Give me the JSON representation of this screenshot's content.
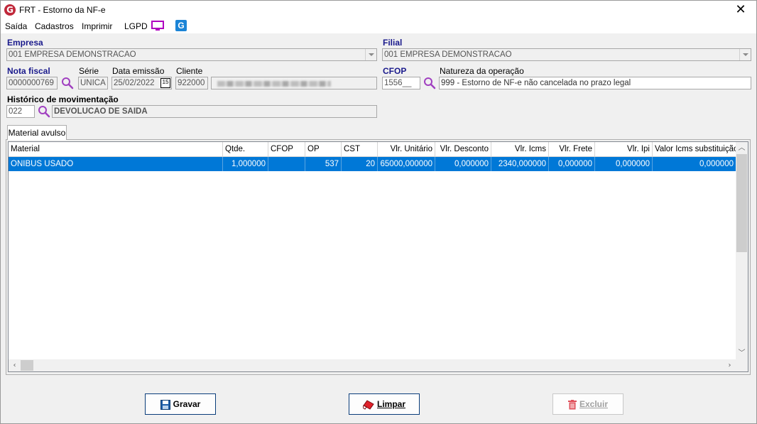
{
  "window": {
    "title": "FRT - Estorno da NF-e",
    "logo_letter": "G"
  },
  "menu": {
    "items": [
      "Saída",
      "Cadastros",
      "Imprimir",
      "LGPD"
    ],
    "g_icon_letter": "G"
  },
  "form": {
    "empresa": {
      "label": "Empresa",
      "value": "001 EMPRESA DEMONSTRACAO"
    },
    "filial": {
      "label": "Filial",
      "value": "001 EMPRESA DEMONSTRACAO"
    },
    "nota_fiscal": {
      "label": "Nota fiscal",
      "value": "0000000769"
    },
    "serie": {
      "label": "Série",
      "value": "UNICA"
    },
    "data_emissao": {
      "label": "Data emissão",
      "value": "25/02/2022",
      "calendar_text": "15"
    },
    "cliente": {
      "label": "Cliente",
      "code": "922000"
    },
    "cfop": {
      "label": "CFOP",
      "value": "1556__"
    },
    "natureza": {
      "label": "Natureza da operação",
      "value": "999 - Estorno de NF-e não cancelada no prazo legal"
    },
    "historico": {
      "label": "Histórico de movimentação",
      "code": "022",
      "description": "DEVOLUCAO DE SAIDA"
    }
  },
  "tabs": [
    {
      "label": "Material avulso"
    }
  ],
  "grid": {
    "columns": [
      "Material",
      "Qtde.",
      "CFOP",
      "OP",
      "CST",
      "Vlr. Unitário",
      "Vlr. Desconto",
      "Vlr. Icms",
      "Vlr. Frete",
      "Vlr. Ipi",
      "Valor Icms substituição"
    ],
    "rows": [
      [
        "ONIBUS USADO",
        "1,000000",
        "",
        "537",
        "20",
        "65000,000000",
        "0,000000",
        "2340,000000",
        "0,000000",
        "0,000000",
        "0,000000"
      ]
    ]
  },
  "buttons": {
    "gravar": "Gravar",
    "limpar": "Limpar",
    "excluir": "Excluir"
  },
  "colors": {
    "selection": "#0078d7",
    "label_blue": "#1a1a8c",
    "lgpd_icon": "#b000c0"
  }
}
